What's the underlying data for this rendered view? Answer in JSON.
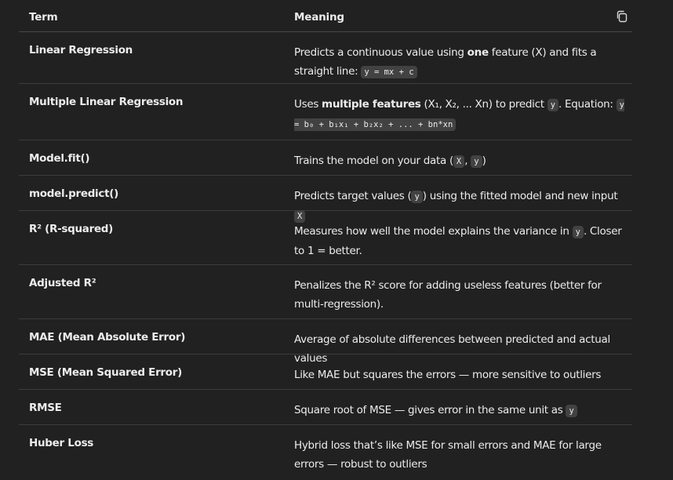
{
  "header": {
    "term": "Term",
    "meaning": "Meaning",
    "copy_icon": "copy-icon"
  },
  "rows": [
    {
      "term": "Linear Regression",
      "meaning_parts": [
        "Predicts a continuous value using ",
        "one",
        " feature (X) and fits a straight line: ",
        "y = mx + c"
      ]
    },
    {
      "term": "Multiple Linear Regression",
      "meaning_parts": [
        "Uses ",
        "multiple features",
        " (X₁, X₂, ... Xn) to predict ",
        "y",
        ". Equation: ",
        "y = b₀ + b₁x₁ + b₂x₂ + ... + bn*xn"
      ]
    },
    {
      "term": "Model.fit()",
      "meaning_parts": [
        "Trains the model on your data (",
        "X",
        ", ",
        "y",
        ")"
      ]
    },
    {
      "term": "model.predict()",
      "meaning_parts": [
        "Predicts target values (",
        "y",
        ") using the fitted model and new input ",
        "X"
      ]
    },
    {
      "term": "R² (R-squared)",
      "meaning_parts": [
        "Measures how well the model explains the variance in ",
        "y",
        ". Closer to 1 = better."
      ]
    },
    {
      "term": "Adjusted R²",
      "meaning_parts": [
        "Penalizes the R² score for adding useless features (better for multi-regression)."
      ]
    },
    {
      "term": "MAE (Mean Absolute Error)",
      "meaning_parts": [
        "Average of absolute differences between predicted and actual values"
      ]
    },
    {
      "term": "MSE (Mean Squared Error)",
      "meaning_parts": [
        "Like MAE but squares the errors — more sensitive to outliers"
      ]
    },
    {
      "term": "RMSE",
      "meaning_parts": [
        "Square root of MSE — gives error in the same unit as ",
        "y"
      ]
    },
    {
      "term": "Huber Loss",
      "meaning_parts": [
        "Hybrid loss that’s like MSE for small errors and MAE for large errors — robust to outliers"
      ]
    }
  ]
}
